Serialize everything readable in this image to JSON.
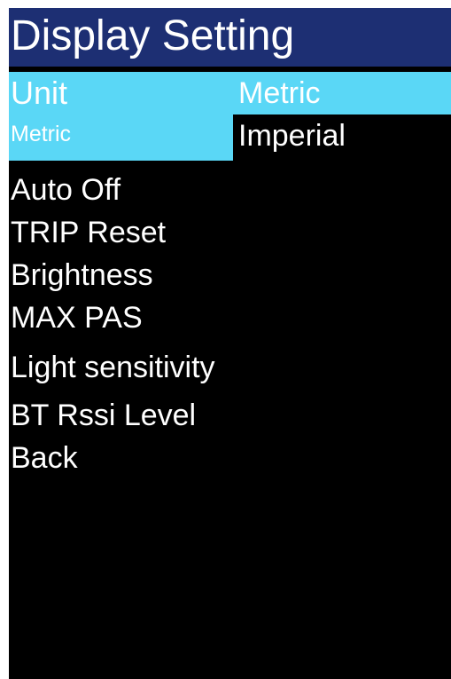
{
  "header": {
    "title": "Display Setting"
  },
  "menu": {
    "selected": {
      "label": "Unit",
      "value": "Metric"
    },
    "items": [
      {
        "label": "Auto Off"
      },
      {
        "label": "TRIP Reset"
      },
      {
        "label": "Brightness"
      },
      {
        "label": "MAX PAS"
      },
      {
        "label": "Light sensitivity"
      },
      {
        "label": "BT Rssi Level"
      },
      {
        "label": "Back"
      }
    ]
  },
  "unit_options": {
    "options": [
      "Metric",
      "Imperial"
    ],
    "highlighted": "Metric"
  },
  "colors": {
    "header_bg": "#1d2f73",
    "highlight_bg": "#5ad7f6",
    "screen_bg": "#000000",
    "text": "#ffffff"
  }
}
